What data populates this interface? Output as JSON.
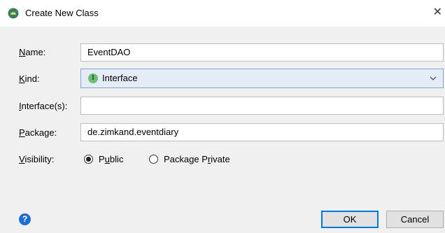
{
  "window": {
    "title": "Create New Class",
    "close_glyph": "✕"
  },
  "form": {
    "name": {
      "label_mnemonic": "N",
      "label_rest": "ame:",
      "value": "EventDAO"
    },
    "kind": {
      "label_mnemonic": "K",
      "label_rest": "ind:",
      "value": "Interface",
      "badge": "I"
    },
    "interfaces": {
      "label_mnemonic": "I",
      "label_rest": "nterface(s):",
      "value": ""
    },
    "package": {
      "label_mnemonic": "P",
      "label_rest": "ackage:",
      "value": "de.zimkand.eventdiary"
    },
    "visibility": {
      "label_mnemonic": "V",
      "label_rest": "isibility:",
      "options": [
        {
          "pre": "P",
          "mnemonic": "u",
          "post": "blic",
          "selected": true
        },
        {
          "pre": "Package P",
          "mnemonic": "r",
          "post": "ivate",
          "selected": false
        }
      ]
    }
  },
  "buttons": {
    "ok": "OK",
    "cancel": "Cancel"
  },
  "help": {
    "glyph": "?"
  }
}
